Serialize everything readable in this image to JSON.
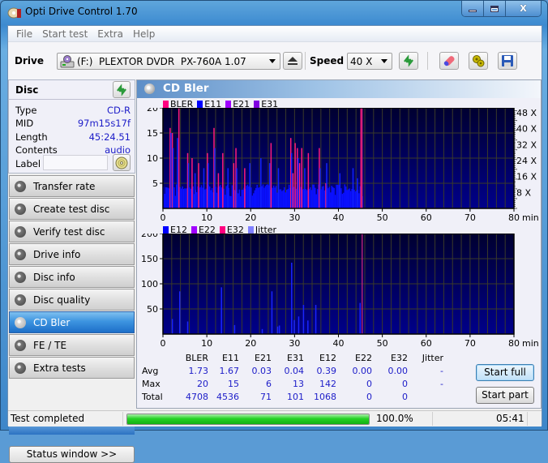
{
  "window": {
    "title": "Opti Drive Control 1.70",
    "minimize": "‒",
    "maximize": "□",
    "close": "X"
  },
  "menu": [
    "File",
    "Start test",
    "Extra",
    "Help"
  ],
  "toolbar": {
    "drive_label": "Drive",
    "drive_value": "(F:)  PLEXTOR DVDR  PX-760A 1.07",
    "speed_label": "Speed",
    "speed_value": "40 X"
  },
  "disc": {
    "title": "Disc",
    "fields": [
      {
        "label": "Type",
        "value": "CD-R"
      },
      {
        "label": "MID",
        "value": "97m15s17f"
      },
      {
        "label": "Length",
        "value": "45:24.51"
      },
      {
        "label": "Contents",
        "value": "audio"
      }
    ],
    "label_field": "Label",
    "label_value": ""
  },
  "nav": [
    {
      "label": "Transfer rate",
      "active": false
    },
    {
      "label": "Create test disc",
      "active": false
    },
    {
      "label": "Verify test disc",
      "active": false
    },
    {
      "label": "Drive info",
      "active": false
    },
    {
      "label": "Disc info",
      "active": false
    },
    {
      "label": "Disc quality",
      "active": false
    },
    {
      "label": "CD Bler",
      "active": true
    },
    {
      "label": "FE / TE",
      "active": false
    },
    {
      "label": "Extra tests",
      "active": false
    }
  ],
  "status_window_button": "Status window >>",
  "main": {
    "title": "CD Bler"
  },
  "chart_data": [
    {
      "type": "bar",
      "title": "BLER / E11 / E21 / E31",
      "legend": [
        {
          "name": "BLER",
          "color": "#ff0080"
        },
        {
          "name": "E11",
          "color": "#0000ff"
        },
        {
          "name": "E21",
          "color": "#a000ff"
        },
        {
          "name": "E31",
          "color": "#8000e0"
        }
      ],
      "xlabel": "min",
      "xlim": [
        0,
        80
      ],
      "xticks": [
        0,
        10,
        20,
        30,
        40,
        50,
        60,
        70,
        80
      ],
      "ylim": [
        0,
        20
      ],
      "yticks": [
        5,
        10,
        15,
        20
      ],
      "y2ticks": [
        "8 X",
        "16 X",
        "24 X",
        "32 X",
        "40 X",
        "48 X"
      ],
      "data_end_min": 45.4,
      "baseline": 4,
      "spikes_bler": [
        [
          1.5,
          16
        ],
        [
          2,
          15
        ],
        [
          3.5,
          20
        ],
        [
          5.5,
          11
        ],
        [
          6.5,
          10
        ],
        [
          8,
          9
        ],
        [
          10,
          11
        ],
        [
          11.5,
          16
        ],
        [
          12.5,
          7
        ],
        [
          13.5,
          11
        ],
        [
          16,
          9
        ],
        [
          16.5,
          12
        ],
        [
          18.5,
          8
        ],
        [
          24.5,
          13
        ],
        [
          29,
          14
        ],
        [
          29.5,
          7
        ],
        [
          30,
          13
        ],
        [
          30.5,
          12
        ],
        [
          31,
          9
        ],
        [
          31.5,
          12
        ],
        [
          33,
          11
        ],
        [
          35.5,
          12
        ],
        [
          37,
          5
        ],
        [
          45,
          24
        ]
      ],
      "spikes_e11": [
        [
          1.5,
          15
        ],
        [
          2,
          12
        ],
        [
          3,
          14
        ],
        [
          5.5,
          9
        ],
        [
          7,
          7
        ],
        [
          9,
          8
        ],
        [
          10,
          9
        ],
        [
          11.5,
          12
        ],
        [
          14.5,
          8
        ],
        [
          16.5,
          8
        ],
        [
          19.5,
          9
        ],
        [
          22,
          10
        ],
        [
          24,
          9
        ],
        [
          26,
          8
        ],
        [
          29,
          11
        ],
        [
          30.5,
          10
        ],
        [
          32,
          8
        ],
        [
          35.5,
          8
        ],
        [
          37,
          9
        ],
        [
          40,
          7
        ],
        [
          43,
          8
        ],
        [
          44,
          6
        ]
      ]
    },
    {
      "type": "bar",
      "title": "E12 / E22 / E32 / Jitter",
      "legend": [
        {
          "name": "E12",
          "color": "#0000ff"
        },
        {
          "name": "E22",
          "color": "#a000ff"
        },
        {
          "name": "E32",
          "color": "#ff0080"
        },
        {
          "name": "Jitter",
          "color": "#8080ff"
        }
      ],
      "xlabel": "min",
      "xlim": [
        0,
        80
      ],
      "xticks": [
        0,
        10,
        20,
        30,
        40,
        50,
        60,
        70,
        80
      ],
      "ylim": [
        0,
        200
      ],
      "yticks": [
        50,
        100,
        150,
        200
      ],
      "data_end_min": 45.4,
      "spikes_e12": [
        [
          2,
          30
        ],
        [
          3.7,
          85
        ],
        [
          5.5,
          25
        ],
        [
          13.2,
          93
        ],
        [
          16.2,
          18
        ],
        [
          22.5,
          10
        ],
        [
          24.7,
          85
        ],
        [
          26,
          15
        ],
        [
          26.4,
          17
        ],
        [
          29.2,
          142
        ],
        [
          29.8,
          28
        ],
        [
          30.8,
          35
        ],
        [
          31.9,
          58
        ],
        [
          32.9,
          27
        ],
        [
          34.7,
          58
        ],
        [
          44.8,
          62
        ]
      ]
    }
  ],
  "stats": {
    "columns": [
      "BLER",
      "E11",
      "E21",
      "E31",
      "E12",
      "E22",
      "E32",
      "Jitter"
    ],
    "rows": [
      {
        "label": "Avg",
        "values": [
          "1.73",
          "1.67",
          "0.03",
          "0.04",
          "0.39",
          "0.00",
          "0.00",
          "-"
        ]
      },
      {
        "label": "Max",
        "values": [
          "20",
          "15",
          "6",
          "13",
          "142",
          "0",
          "0",
          "-"
        ]
      },
      {
        "label": "Total",
        "values": [
          "4708",
          "4536",
          "71",
          "101",
          "1068",
          "0",
          "0",
          ""
        ]
      }
    ]
  },
  "buttons": {
    "start_full": "Start full",
    "start_part": "Start part"
  },
  "statusbar": {
    "text": "Test completed",
    "progress_percent": 100.0,
    "progress_label": "100.0%",
    "time": "05:41"
  }
}
